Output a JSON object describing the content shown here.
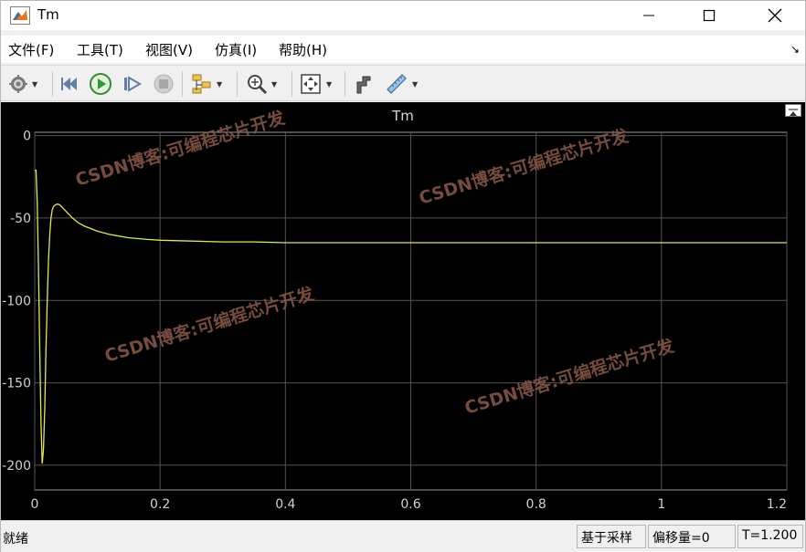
{
  "window": {
    "title": "Tm"
  },
  "menu": {
    "items": [
      {
        "label": "文件(F)"
      },
      {
        "label": "工具(T)"
      },
      {
        "label": "视图(V)"
      },
      {
        "label": "仿真(I)"
      },
      {
        "label": "帮助(H)"
      }
    ]
  },
  "toolbar": {
    "icons": [
      "gear-icon",
      "rewind-icon",
      "run-icon",
      "step-forward-icon",
      "stop-icon",
      "highlight-block-icon",
      "zoom-icon",
      "autoscale-icon",
      "cursor-measure-icon",
      "ruler-icon"
    ]
  },
  "plot": {
    "title": "Tm",
    "line_color": "#e6e84a",
    "grid_color": "#555555",
    "background": "#000000"
  },
  "watermarks": [
    "CSDN博客:可编程芯片开发",
    "CSDN博客:可编程芯片开发",
    "CSDN博客:可编程芯片开发",
    "CSDN博客:可编程芯片开发"
  ],
  "status": {
    "ready": "就绪",
    "sample_based": "基于采样",
    "offset": "偏移量=0",
    "time": "T=1.200"
  },
  "chart_data": {
    "type": "line",
    "title": "Tm",
    "xlim": [
      0,
      1.2
    ],
    "ylim": [
      -215,
      2
    ],
    "xticks": [
      0,
      0.2,
      0.4,
      0.6,
      0.8,
      1,
      1.2
    ],
    "xtick_labels": [
      "0",
      "0.2",
      "0.4",
      "0.6",
      "0.8",
      "1",
      "1.2"
    ],
    "yticks": [
      0,
      -50,
      -100,
      -150,
      -200
    ],
    "ytick_labels": [
      "0",
      "-50",
      "-100",
      "-150",
      "-200"
    ],
    "grid": true,
    "series": [
      {
        "x": [
          0,
          0.002,
          0.004,
          0.006,
          0.008,
          0.01,
          0.012,
          0.014,
          0.016,
          0.018,
          0.02,
          0.022,
          0.024,
          0.026,
          0.028,
          0.03,
          0.033,
          0.036,
          0.04,
          0.045,
          0.05,
          0.06,
          0.07,
          0.08,
          0.1,
          0.12,
          0.15,
          0.18,
          0.2,
          0.25,
          0.3,
          0.35,
          0.4,
          0.5,
          0.6,
          0.7,
          0.8,
          0.9,
          1.0,
          1.1,
          1.2
        ],
        "y": [
          -21,
          -21,
          -40,
          -80,
          -130,
          -175,
          -199,
          -190,
          -165,
          -130,
          -100,
          -75,
          -60,
          -50,
          -45,
          -43,
          -42,
          -41.5,
          -42,
          -44,
          -46,
          -50,
          -53,
          -55,
          -58,
          -60,
          -62,
          -63,
          -63.5,
          -64,
          -64.5,
          -64.5,
          -65,
          -65,
          -65,
          -65,
          -65,
          -65,
          -65,
          -65,
          -65
        ]
      }
    ]
  }
}
